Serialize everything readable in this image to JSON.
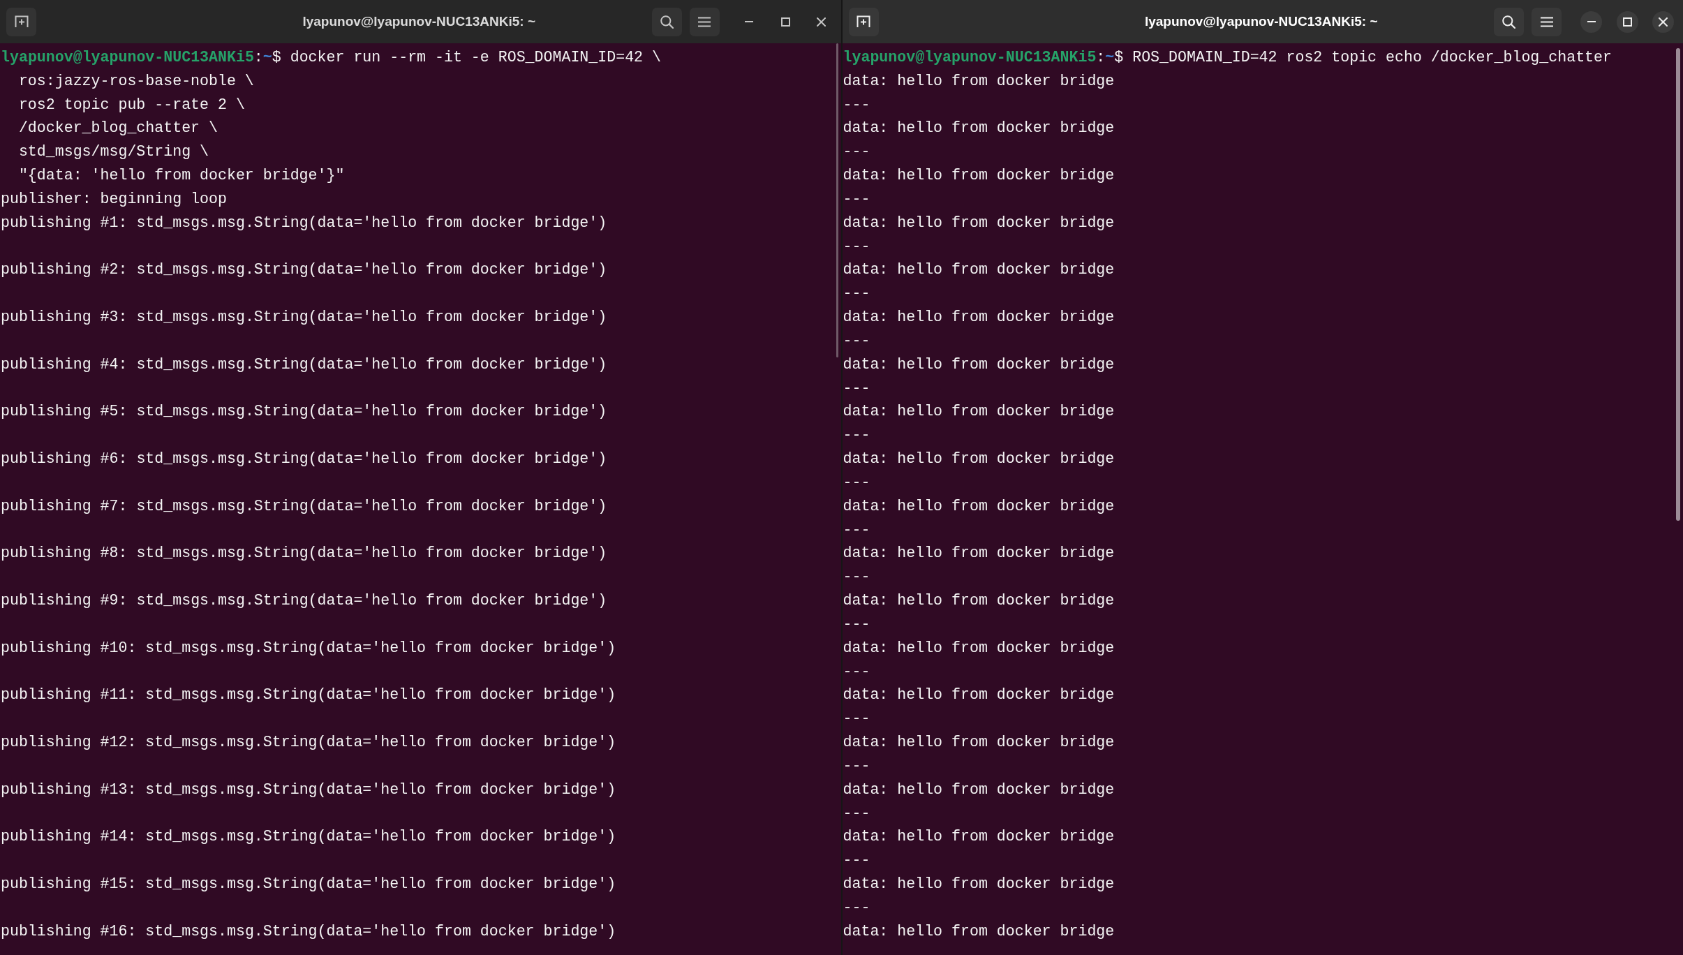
{
  "windows": [
    {
      "title": "lyapunov@lyapunov-NUC13ANKi5: ~",
      "focused": false,
      "lines": [
        {
          "kind": "prompt",
          "user_host": "lyapunov@lyapunov-NUC13ANKi5",
          "separator": ":",
          "path": "~",
          "symbol": "$",
          "command": "docker run --rm -it -e ROS_DOMAIN_ID=42 \\"
        },
        {
          "kind": "continuation",
          "text": "ros:jazzy-ros-base-noble \\"
        },
        {
          "kind": "continuation",
          "text": "ros2 topic pub --rate 2 \\"
        },
        {
          "kind": "continuation",
          "text": "/docker_blog_chatter \\"
        },
        {
          "kind": "continuation",
          "text": "std_msgs/msg/String \\"
        },
        {
          "kind": "continuation",
          "text": "\"{data: 'hello from docker bridge'}\""
        },
        {
          "kind": "output",
          "text": "publisher: beginning loop"
        },
        {
          "kind": "output",
          "text": "publishing #1: std_msgs.msg.String(data='hello from docker bridge')"
        },
        {
          "kind": "blank"
        },
        {
          "kind": "output",
          "text": "publishing #2: std_msgs.msg.String(data='hello from docker bridge')"
        },
        {
          "kind": "blank"
        },
        {
          "kind": "output",
          "text": "publishing #3: std_msgs.msg.String(data='hello from docker bridge')"
        },
        {
          "kind": "blank"
        },
        {
          "kind": "output",
          "text": "publishing #4: std_msgs.msg.String(data='hello from docker bridge')"
        },
        {
          "kind": "blank"
        },
        {
          "kind": "output",
          "text": "publishing #5: std_msgs.msg.String(data='hello from docker bridge')"
        },
        {
          "kind": "blank"
        },
        {
          "kind": "output",
          "text": "publishing #6: std_msgs.msg.String(data='hello from docker bridge')"
        },
        {
          "kind": "blank"
        },
        {
          "kind": "output",
          "text": "publishing #7: std_msgs.msg.String(data='hello from docker bridge')"
        },
        {
          "kind": "blank"
        },
        {
          "kind": "output",
          "text": "publishing #8: std_msgs.msg.String(data='hello from docker bridge')"
        },
        {
          "kind": "blank"
        },
        {
          "kind": "output",
          "text": "publishing #9: std_msgs.msg.String(data='hello from docker bridge')"
        },
        {
          "kind": "blank"
        },
        {
          "kind": "output",
          "text": "publishing #10: std_msgs.msg.String(data='hello from docker bridge')"
        },
        {
          "kind": "blank"
        },
        {
          "kind": "output",
          "text": "publishing #11: std_msgs.msg.String(data='hello from docker bridge')"
        },
        {
          "kind": "blank"
        },
        {
          "kind": "output",
          "text": "publishing #12: std_msgs.msg.String(data='hello from docker bridge')"
        },
        {
          "kind": "blank"
        },
        {
          "kind": "output",
          "text": "publishing #13: std_msgs.msg.String(data='hello from docker bridge')"
        },
        {
          "kind": "blank"
        },
        {
          "kind": "output",
          "text": "publishing #14: std_msgs.msg.String(data='hello from docker bridge')"
        },
        {
          "kind": "blank"
        },
        {
          "kind": "output",
          "text": "publishing #15: std_msgs.msg.String(data='hello from docker bridge')"
        },
        {
          "kind": "blank"
        },
        {
          "kind": "output",
          "text": "publishing #16: std_msgs.msg.String(data='hello from docker bridge')"
        }
      ]
    },
    {
      "title": "lyapunov@lyapunov-NUC13ANKi5: ~",
      "focused": true,
      "lines": [
        {
          "kind": "prompt",
          "user_host": "lyapunov@lyapunov-NUC13ANKi5",
          "separator": ":",
          "path": "~",
          "symbol": "$",
          "command": "ROS_DOMAIN_ID=42 ros2 topic echo /docker_blog_chatter"
        },
        {
          "kind": "output",
          "text": "data: hello from docker bridge"
        },
        {
          "kind": "output",
          "text": "---"
        },
        {
          "kind": "output",
          "text": "data: hello from docker bridge"
        },
        {
          "kind": "output",
          "text": "---"
        },
        {
          "kind": "output",
          "text": "data: hello from docker bridge"
        },
        {
          "kind": "output",
          "text": "---"
        },
        {
          "kind": "output",
          "text": "data: hello from docker bridge"
        },
        {
          "kind": "output",
          "text": "---"
        },
        {
          "kind": "output",
          "text": "data: hello from docker bridge"
        },
        {
          "kind": "output",
          "text": "---"
        },
        {
          "kind": "output",
          "text": "data: hello from docker bridge"
        },
        {
          "kind": "output",
          "text": "---"
        },
        {
          "kind": "output",
          "text": "data: hello from docker bridge"
        },
        {
          "kind": "output",
          "text": "---"
        },
        {
          "kind": "output",
          "text": "data: hello from docker bridge"
        },
        {
          "kind": "output",
          "text": "---"
        },
        {
          "kind": "output",
          "text": "data: hello from docker bridge"
        },
        {
          "kind": "output",
          "text": "---"
        },
        {
          "kind": "output",
          "text": "data: hello from docker bridge"
        },
        {
          "kind": "output",
          "text": "---"
        },
        {
          "kind": "output",
          "text": "data: hello from docker bridge"
        },
        {
          "kind": "output",
          "text": "---"
        },
        {
          "kind": "output",
          "text": "data: hello from docker bridge"
        },
        {
          "kind": "output",
          "text": "---"
        },
        {
          "kind": "output",
          "text": "data: hello from docker bridge"
        },
        {
          "kind": "output",
          "text": "---"
        },
        {
          "kind": "output",
          "text": "data: hello from docker bridge"
        },
        {
          "kind": "output",
          "text": "---"
        },
        {
          "kind": "output",
          "text": "data: hello from docker bridge"
        },
        {
          "kind": "output",
          "text": "---"
        },
        {
          "kind": "output",
          "text": "data: hello from docker bridge"
        },
        {
          "kind": "output",
          "text": "---"
        },
        {
          "kind": "output",
          "text": "data: hello from docker bridge"
        },
        {
          "kind": "output",
          "text": "---"
        },
        {
          "kind": "output",
          "text": "data: hello from docker bridge"
        },
        {
          "kind": "output",
          "text": "---"
        },
        {
          "kind": "output",
          "text": "data: hello from docker bridge"
        }
      ]
    }
  ]
}
